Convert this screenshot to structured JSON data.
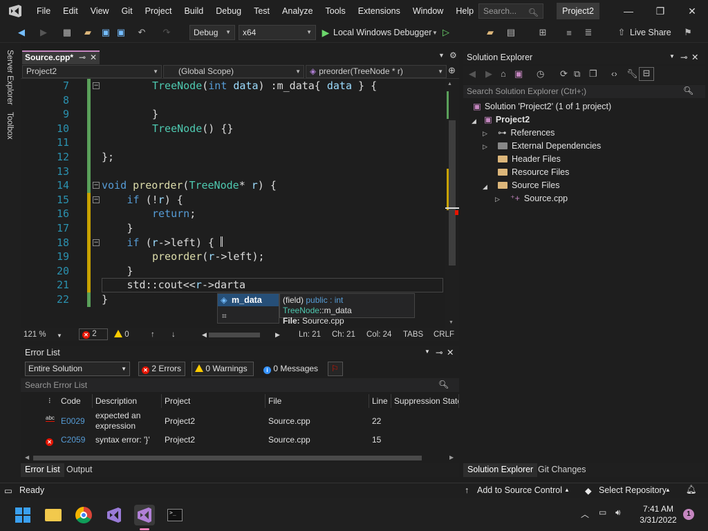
{
  "menu": {
    "items": [
      "File",
      "Edit",
      "View",
      "Git",
      "Project",
      "Build",
      "Debug",
      "Test",
      "Analyze",
      "Tools",
      "Extensions",
      "Window",
      "Help"
    ],
    "search_placeholder": "Search...",
    "project_name": "Project2"
  },
  "toolbar": {
    "config": "Debug",
    "platform": "x64",
    "run_label": "Local Windows Debugger",
    "live_share": "Live Share"
  },
  "side": {
    "server_explorer": "Server Explorer",
    "toolbox": "Toolbox"
  },
  "document": {
    "tab_label": "Source.cpp*",
    "nav_project": "Project2",
    "nav_scope": "(Global Scope)",
    "nav_member": "preorder(TreeNode * r)"
  },
  "code_lines": [
    {
      "n": "7",
      "code": "TreeNode(int data) :m_data{ data } {"
    },
    {
      "n": "8",
      "code": ""
    },
    {
      "n": "9",
      "code": "}"
    },
    {
      "n": "10",
      "code": "TreeNode() {}"
    },
    {
      "n": "11",
      "code": ""
    },
    {
      "n": "12",
      "code": "};"
    },
    {
      "n": "13",
      "code": ""
    },
    {
      "n": "14",
      "code": "void preorder(TreeNode* r) {"
    },
    {
      "n": "15",
      "code": "if (!r) {"
    },
    {
      "n": "16",
      "code": "return;"
    },
    {
      "n": "17",
      "code": "}"
    },
    {
      "n": "18",
      "code": "if (r->left) {"
    },
    {
      "n": "19",
      "code": "preorder(r->left);"
    },
    {
      "n": "20",
      "code": "}"
    },
    {
      "n": "21",
      "code": "std::cout<<r->darta"
    },
    {
      "n": "22",
      "code": "}"
    }
  ],
  "intellisense": {
    "item": "m_data",
    "tip_kind": "(field)",
    "tip_access": "public : int",
    "tip_type": "TreeNode",
    "tip_member": "::m_data",
    "tip_file_label": "File:",
    "tip_file": "Source.cpp"
  },
  "editor_status": {
    "zoom": "121 %",
    "errors": "2",
    "warnings": "0",
    "ln": "Ln: 21",
    "ch": "Ch: 21",
    "col": "Col: 24",
    "tabs": "TABS",
    "eol": "CRLF"
  },
  "error_list": {
    "title": "Error List",
    "scope": "Entire Solution",
    "errors_btn": "2 Errors",
    "warnings_btn": "0 Warnings",
    "messages_btn": "0 Messages",
    "search_placeholder": "Search Error List",
    "columns": [
      "Code",
      "Description",
      "Project",
      "File",
      "Line",
      "Suppression State"
    ],
    "rows": [
      {
        "code": "E0029",
        "desc1": "expected an",
        "desc2": "expression",
        "project": "Project2",
        "file": "Source.cpp",
        "line": "22"
      },
      {
        "code": "C2059",
        "desc1": "syntax error: '}'",
        "desc2": "",
        "project": "Project2",
        "file": "Source.cpp",
        "line": "15"
      }
    ],
    "tabs": [
      "Error List",
      "Output"
    ]
  },
  "solution_explorer": {
    "title": "Solution Explorer",
    "search_placeholder": "Search Solution Explorer (Ctrl+;)",
    "solution": "Solution 'Project2' (1 of 1 project)",
    "project": "Project2",
    "items": [
      "References",
      "External Dependencies",
      "Header Files",
      "Resource Files",
      "Source Files"
    ],
    "file": "Source.cpp",
    "tabs": [
      "Solution Explorer",
      "Git Changes"
    ]
  },
  "statusbar": {
    "ready": "Ready",
    "add_source": "Add to Source Control",
    "select_repo": "Select Repository"
  },
  "taskbar": {
    "time": "7:41 AM",
    "date": "3/31/2022",
    "notif": "1"
  },
  "colors": {
    "accent": "#c586c0",
    "error": "#e51400",
    "warning": "#ffcc00",
    "selection": "#264f78"
  }
}
